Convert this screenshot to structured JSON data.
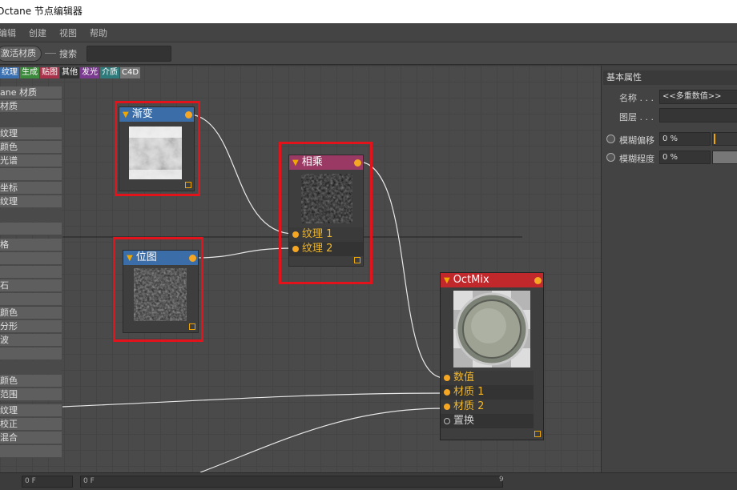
{
  "window": {
    "title": "Octane 节点编辑器"
  },
  "menu": [
    "编辑",
    "创建",
    "视图",
    "帮助"
  ],
  "toolbar": {
    "activate_label": "激活材质",
    "search_label": "搜索",
    "search_value": ""
  },
  "tags": [
    {
      "label": "纹理",
      "color": "#3a6fb0"
    },
    {
      "label": "生成",
      "color": "#3c8a3c"
    },
    {
      "label": "贴图",
      "color": "#a8324a"
    },
    {
      "label": "其他",
      "color": "#333333"
    },
    {
      "label": "发光",
      "color": "#7a3a8f"
    },
    {
      "label": "介质",
      "color": "#2f7a7a"
    },
    {
      "label": "C4D",
      "color": "#777777"
    }
  ],
  "left_list": [
    "ane 材质",
    "材质",
    "",
    "纹理",
    "颜色",
    "光谱",
    "",
    "坐标",
    "纹理",
    "",
    "",
    "格",
    "",
    "",
    "石",
    "",
    "颜色",
    "分形",
    "波",
    "",
    "",
    "颜色",
    "范围",
    "纹理",
    "校正",
    "混合",
    ""
  ],
  "nodes": {
    "gradient": {
      "title": "渐变"
    },
    "bitmap": {
      "title": "位图"
    },
    "multiply": {
      "title": "相乘",
      "inputs": [
        "纹理 1",
        "纹理 2"
      ]
    },
    "octmix": {
      "title": "OctMix",
      "inputs": [
        "数值",
        "材质 1",
        "材质 2",
        "置换"
      ]
    }
  },
  "right_panel": {
    "header": "基本属性",
    "name_label": "名称 . . .",
    "name_value": "<<多重数值>>",
    "layer_label": "图层 . . .",
    "blur_offset_label": "模糊偏移",
    "blur_offset_value": "0 %",
    "blur_amount_label": "模糊程度",
    "blur_amount_value": "0 %"
  },
  "bottom": {
    "frame_left": "0 F",
    "frame_right": "0 F",
    "right_edge_digit": "9"
  },
  "colors": {
    "node_blue": "#3b6ea8",
    "node_pink": "#9a3a64",
    "node_red": "#c0282c",
    "port": "#f5a623",
    "highlight": "#e3131b"
  }
}
